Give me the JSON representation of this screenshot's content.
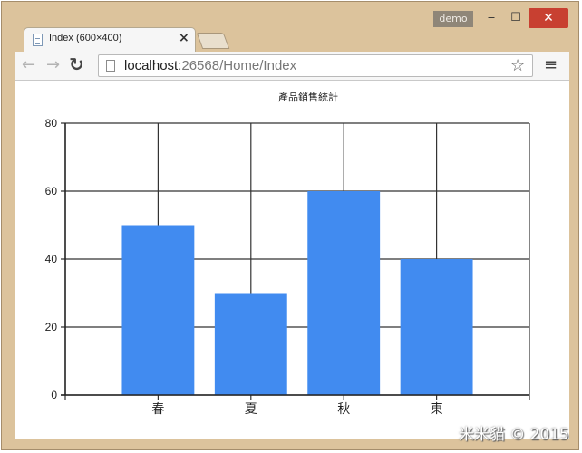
{
  "window": {
    "user_label": "demo",
    "minimize_glyph": "‒",
    "maximize_glyph": "☐",
    "close_glyph": "✕"
  },
  "tab": {
    "title": "Index (600×400)",
    "close_glyph": "×"
  },
  "toolbar": {
    "back_glyph": "←",
    "forward_glyph": "→",
    "reload_glyph": "↻",
    "url_host": "localhost",
    "url_path": ":26568/Home/Index",
    "star_glyph": "☆",
    "menu_glyph": "≡"
  },
  "chart_data": {
    "type": "bar",
    "title": "產品銷售統計",
    "categories": [
      "春",
      "夏",
      "秋",
      "東"
    ],
    "values": [
      50,
      30,
      60,
      40
    ],
    "ylim": [
      0,
      80
    ],
    "yticks": [
      0,
      20,
      40,
      60,
      80
    ],
    "xlabel": "",
    "ylabel": "",
    "grid": true,
    "bar_color": "#418bf0"
  },
  "watermark": "米米貓 © 2015"
}
